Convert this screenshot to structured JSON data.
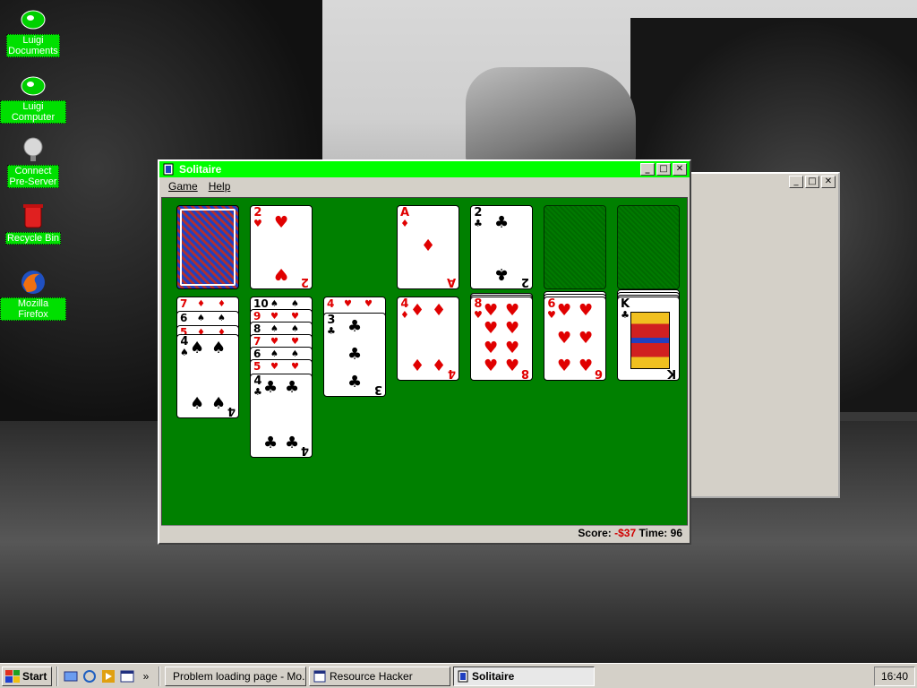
{
  "desktop": {
    "icons": [
      {
        "label": "Luigi\nDocuments",
        "icon": "folder-icon"
      },
      {
        "label": "Luigi Computer",
        "icon": "computer-icon"
      },
      {
        "label": "Connect\nPre-Server",
        "icon": "server-icon"
      },
      {
        "label": "Recycle Bin",
        "icon": "recycle-bin-icon"
      },
      {
        "label": "Mozilla Firefox",
        "icon": "firefox-icon"
      }
    ]
  },
  "solitaire": {
    "title": "Solitaire",
    "menu": [
      "Game",
      "Help"
    ],
    "status": {
      "score_label": "Score:",
      "score_value": "-$37",
      "time_label": "Time:",
      "time_value": "96"
    },
    "waste_card": {
      "rank": "2",
      "suit": "♥"
    },
    "foundations": [
      {
        "rank": "A",
        "suit": "♦",
        "color": "red"
      },
      {
        "rank": "2",
        "suit": "♣",
        "color": "black"
      }
    ],
    "tableau": [
      {
        "stubs": [
          {
            "rank": "7",
            "suit": "♦",
            "color": "red"
          },
          {
            "rank": "6",
            "suit": "♠",
            "color": "black"
          },
          {
            "rank": "5",
            "suit": "♦",
            "color": "red"
          }
        ],
        "top": {
          "rank": "4",
          "suit": "♠",
          "color": "black"
        }
      },
      {
        "stubs": [
          {
            "rank": "10",
            "suit": "♠",
            "color": "black"
          },
          {
            "rank": "9",
            "suit": "♥",
            "color": "red"
          },
          {
            "rank": "8",
            "suit": "♠",
            "color": "black"
          },
          {
            "rank": "7",
            "suit": "♥",
            "color": "red"
          },
          {
            "rank": "6",
            "suit": "♠",
            "color": "black"
          },
          {
            "rank": "5",
            "suit": "♥",
            "color": "red"
          }
        ],
        "top": {
          "rank": "4",
          "suit": "♣",
          "color": "black"
        }
      },
      {
        "stubs": [
          {
            "rank": "4",
            "suit": "♥",
            "color": "red"
          }
        ],
        "top": {
          "rank": "3",
          "suit": "♣",
          "color": "black"
        }
      },
      {
        "stubs": [],
        "top": {
          "rank": "4",
          "suit": "♦",
          "color": "red"
        }
      },
      {
        "stubs": [],
        "top": {
          "rank": "8",
          "suit": "♥",
          "color": "red"
        }
      },
      {
        "stubs": [],
        "top": {
          "rank": "6",
          "suit": "♥",
          "color": "red"
        }
      },
      {
        "stubs": [],
        "top": {
          "rank": "K",
          "suit": "♣",
          "color": "black"
        }
      }
    ]
  },
  "taskbar": {
    "start_label": "Start",
    "quick_launch": [
      "desktop-icon",
      "refresh-icon",
      "media-icon",
      "window-icon"
    ],
    "overflow": "»",
    "tasks": [
      {
        "label": "Problem loading page - Mo...",
        "icon": "firefox-icon",
        "active": false
      },
      {
        "label": "Resource Hacker",
        "icon": "resource-hacker-icon",
        "active": false
      },
      {
        "label": "Solitaire",
        "icon": "solitaire-icon",
        "active": true
      }
    ],
    "clock": "16:40"
  },
  "colors": {
    "titlebar": "#00ff00",
    "felt": "#008000",
    "icon_label_bg": "#00e000",
    "red_suit": "#e00000"
  }
}
